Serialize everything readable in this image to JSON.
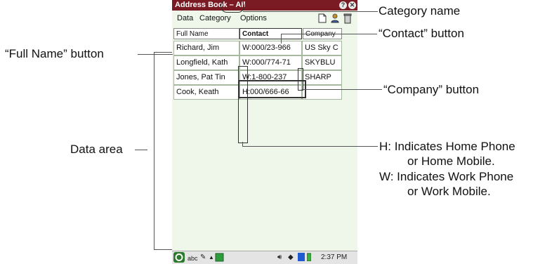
{
  "annotations": {
    "category_name": "Category name",
    "contact_button": "“Contact” button",
    "full_name_button": "“Full Name” button",
    "company_button": "“Company” button",
    "data_area": "Data area",
    "h_line1": "H:  Indicates Home Phone",
    "h_line2": "or Home Mobile.",
    "w_line1": "W: Indicates Work Phone",
    "w_line2": "or Work Mobile."
  },
  "window": {
    "title": "Address Book – All",
    "help_glyph": "?",
    "close_glyph": "✕"
  },
  "menu": [
    "Data",
    "Category",
    "Options"
  ],
  "toolbar_icons": [
    "new-document-icon",
    "contact-person-icon",
    "trash-icon"
  ],
  "columns": [
    "Full Name",
    "Contact",
    "Company"
  ],
  "rows": [
    {
      "name": "Richard, Jim",
      "contact": "W:000/23-966",
      "company": "US Sky C"
    },
    {
      "name": "Longfield, Kath",
      "contact": "W:000/774-71",
      "company": "SKYBLU"
    },
    {
      "name": "Jones, Pat Tin",
      "contact": "W:1-800-237",
      "company": "SHARP"
    },
    {
      "name": "Cook, Keath",
      "contact": "H:000/666-66",
      "company": ""
    }
  ],
  "status": {
    "input_mode": "abc",
    "time": "2:37 PM"
  },
  "colors": {
    "titlebar": "#7a1a22",
    "screen_bg": "#eef7ea"
  }
}
